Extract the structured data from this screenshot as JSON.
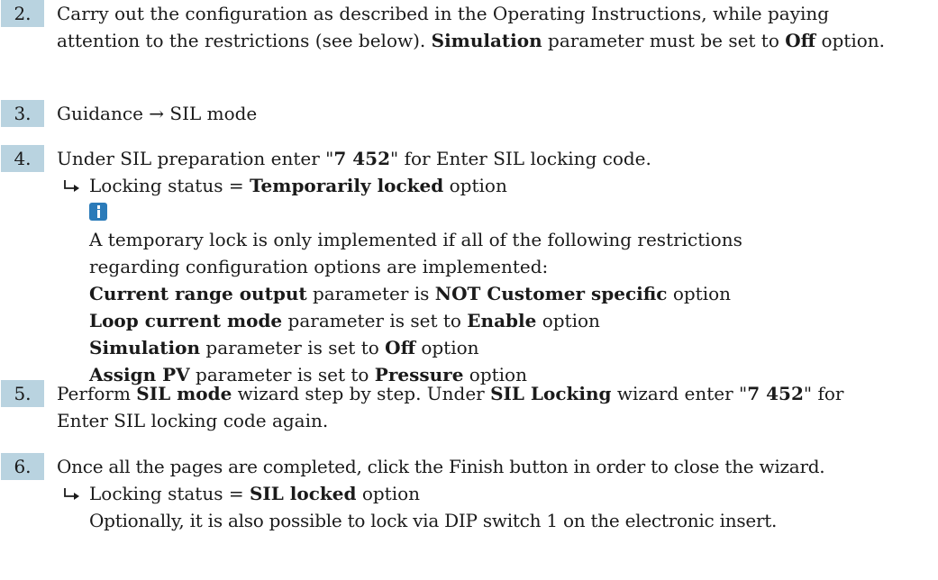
{
  "steps": [
    {
      "number": "2.",
      "t1": "Carry out the configuration as described in the Operating Instructions, while paying attention to the restrictions (see below). ",
      "b1": "Simulation",
      "t2": " parameter must be set to ",
      "b2": "Off",
      "t3": " option."
    },
    {
      "number": "3.",
      "text": "Guidance → SIL mode"
    },
    {
      "number": "4.",
      "t1": "Under SIL preparation enter \"",
      "b1": "7 452",
      "t2": "\" for Enter SIL locking code.",
      "result": {
        "t1": "Locking status = ",
        "b1": "Temporarily locked",
        "t2": " option",
        "icon": "info-icon",
        "note": "A temporary lock is only implemented if all of the following restrictions regarding configuration options are implemented:",
        "restrictions": [
          {
            "b1": "Current range output",
            "t1": " parameter is ",
            "b2": "NOT Customer specific",
            "t2": " option"
          },
          {
            "b1": "Loop current mode",
            "t1": " parameter is set to ",
            "b2": "Enable",
            "t2": " option"
          },
          {
            "b1": "Simulation",
            "t1": " parameter is set to ",
            "b2": "Off",
            "t2": " option"
          },
          {
            "b1": "Assign PV",
            "t1": " parameter is set to ",
            "b2": "Pressure",
            "t2": " option"
          }
        ]
      }
    },
    {
      "number": "5.",
      "t1": "Perform ",
      "b1": "SIL mode",
      "t2": " wizard step by step. Under ",
      "b2": "SIL Locking",
      "t3": " wizard enter \"",
      "b3": "7 452",
      "t4": "\" for Enter SIL locking code again."
    },
    {
      "number": "6.",
      "text": "Once all the pages are completed, click the Finish button in order to close the wizard.",
      "result": {
        "t1": "Locking status = ",
        "b1": "SIL locked",
        "t2": " option",
        "note": "Optionally, it is also possible to lock via DIP switch 1 on the electronic insert."
      }
    }
  ],
  "colors": {
    "step_badge": "#b9d3e0",
    "info_icon": "#2b7bb9",
    "text": "#1a1a1a"
  }
}
